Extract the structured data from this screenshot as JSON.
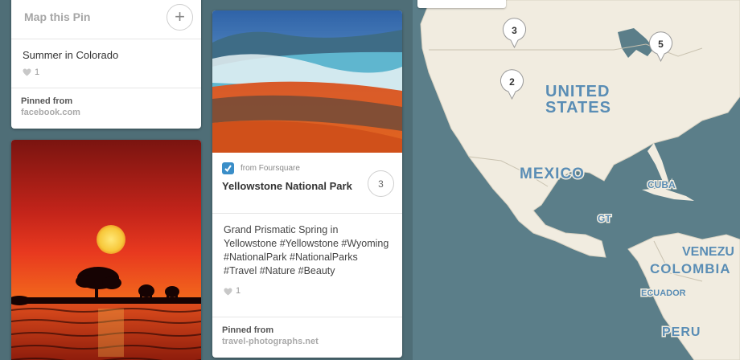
{
  "pin_card_colorado": {
    "map_this_pin_label": "Map this Pin",
    "add_icon": "plus-icon",
    "description": "Summer in Colorado",
    "like_count": "1",
    "pinned_from_label": "Pinned from",
    "pinned_from_site": "facebook.com"
  },
  "pin_card_sunset": {
    "image": "african-sunset-elephants-photo"
  },
  "pin_card_yellowstone": {
    "image": "grand-prismatic-spring-photo",
    "source_icon": "foursquare-icon",
    "source_label": "from Foursquare",
    "place_title": "Yellowstone National Park",
    "place_pin_count": "3",
    "description": "Grand Prismatic Spring in Yellowstone #Yellowstone #Wyoming #NationalPark #NationalParks #Travel #Nature #Beauty",
    "like_count": "1",
    "pinned_from_label": "Pinned from",
    "pinned_from_site": "travel-photographs.net"
  },
  "map": {
    "markers": [
      {
        "count": "3",
        "name": "marker-montana"
      },
      {
        "count": "2",
        "name": "marker-colorado"
      },
      {
        "count": "5",
        "name": "marker-great-lakes"
      }
    ],
    "labels": {
      "united": "UNITED",
      "states": "STATES",
      "mexico": "MEXICO",
      "cuba": "CUBA",
      "gt": "GT",
      "venezuela": "VENEZU",
      "colombia": "COLOMBIA",
      "ecuador": "ECUADOR",
      "peru": "PERU"
    },
    "colors": {
      "water": "#5a7d88",
      "land": "#f1ece0",
      "label": "#5a8db5"
    }
  }
}
